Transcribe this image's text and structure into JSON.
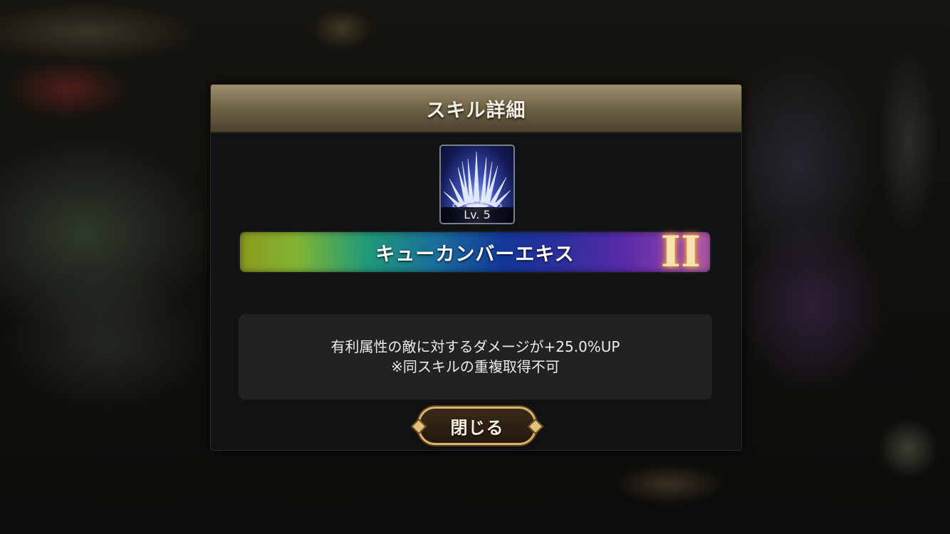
{
  "dialog": {
    "title": "スキル詳細",
    "skill": {
      "icon": "ice-spikes-skill-icon",
      "level_label": "Lv. 5",
      "name": "キューカンバーエキス",
      "rank": "II"
    },
    "description": {
      "line1": "有利属性の敵に対するダメージが+25.0%UP",
      "line2": "※同スキルの重複取得不可"
    },
    "close_button_label": "閉じる"
  },
  "colors": {
    "header": "#9c8f6c",
    "panel": "#111214",
    "description_box": "#222222",
    "button_border": "#d9b26b",
    "rank_glow": "#ffb54a"
  }
}
